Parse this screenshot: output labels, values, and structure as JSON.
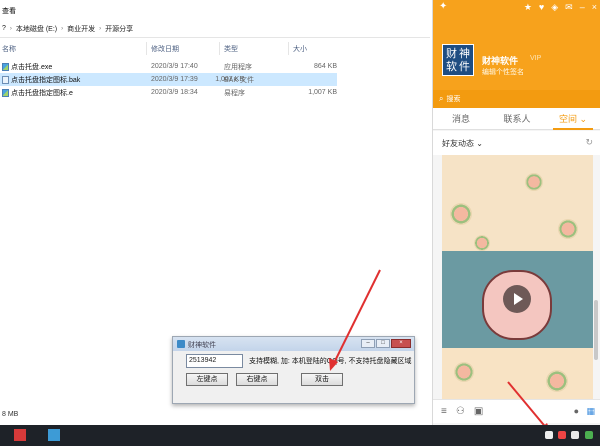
{
  "explorer": {
    "title": "查看",
    "breadcrumb": [
      "本地磁盘 (E:)",
      "商业开发",
      "开源分享"
    ],
    "breadcrumb_lead": "?",
    "columns": {
      "name": "名称",
      "date": "修改日期",
      "type": "类型",
      "size": "大小"
    },
    "files": [
      {
        "name": "点击托盘.exe",
        "date": "2020/3/9 17:40",
        "type": "应用程序",
        "size": "864 KB",
        "selected": false
      },
      {
        "name": "点击托盘指定图标.bak",
        "date": "2020/3/9 17:39",
        "type": "BAK 文件",
        "size": "1,007 KB",
        "selected": true
      },
      {
        "name": "点击托盘指定图标.e",
        "date": "2020/3/9 18:34",
        "type": "易程序",
        "size": "1,007 KB",
        "selected": false
      }
    ],
    "status": "8 MB"
  },
  "qq": {
    "avatar_chars": [
      "财",
      "神",
      "软",
      "件"
    ],
    "nickname": "财神软件",
    "vip": "VIP",
    "signature": "编辑个性签名",
    "search_placeholder": "搜索",
    "tabs": [
      {
        "label": "消息",
        "active": false
      },
      {
        "label": "联系人",
        "active": false
      },
      {
        "label": "空间",
        "active": true
      }
    ],
    "feed_title": "好友动态"
  },
  "dialog": {
    "title": "财神软件",
    "input_value": "2513942",
    "hint": "支持模糊, 加: 本机登陆的QQ号, 不支持托盘隐藏区域",
    "buttons": {
      "left": "左键点",
      "right": "右键点",
      "double": "双击"
    }
  },
  "colors": {
    "qq_orange": "#f7a21c",
    "selection": "#cce8ff",
    "arrow_red": "#e03030"
  }
}
